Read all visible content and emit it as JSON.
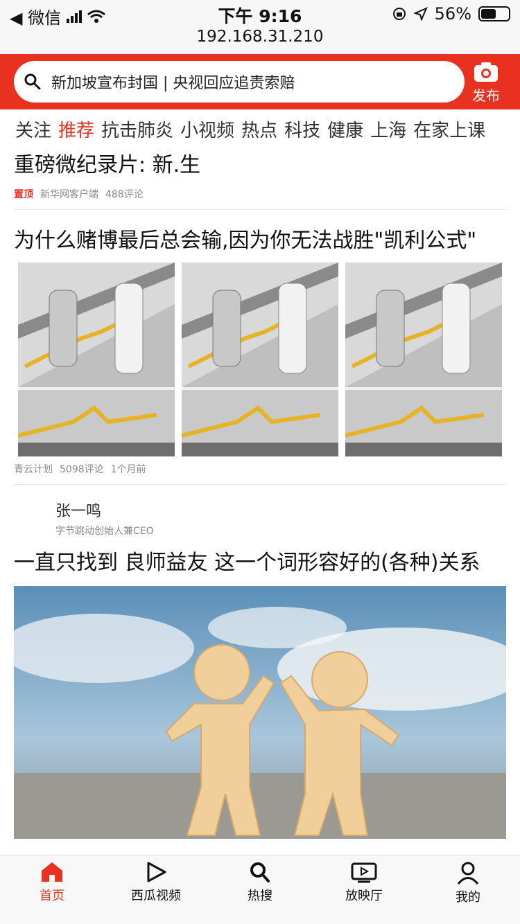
{
  "status": {
    "back_app": "◀ 微信",
    "time": "下午 9:16",
    "url": "192.168.31.210",
    "battery_percent": "56%",
    "battery_level": 0.56
  },
  "search": {
    "query": "新加坡宣布封国 | 央视回应追责索赔"
  },
  "publish": {
    "label": "发布"
  },
  "tabs": [
    {
      "label": "关注"
    },
    {
      "label": "推荐"
    },
    {
      "label": "抗击肺炎"
    },
    {
      "label": "小视频"
    },
    {
      "label": "热点"
    },
    {
      "label": "科技"
    },
    {
      "label": "健康"
    },
    {
      "label": "上海"
    },
    {
      "label": "在家上课"
    }
  ],
  "feed": {
    "item1": {
      "title": "重磅微纪录片: 新.生",
      "tag": "置顶",
      "source": "新华网客户端",
      "comments": "488评论"
    },
    "item2": {
      "title": "为什么赌博最后总会输,因为你无法战胜\"凯利公式\"",
      "source": "青云计划",
      "comments": "5098评论",
      "time": "1个月前"
    },
    "item3": {
      "author_name": "张一鸣",
      "author_desc": "字节跳动创始人兼CEO",
      "title": "一直只找到 良师益友 这一个词形容好的(各种)关系"
    }
  },
  "bottomnav": [
    {
      "label": "首页",
      "icon": "home-icon"
    },
    {
      "label": "西瓜视频",
      "icon": "play-icon"
    },
    {
      "label": "热搜",
      "icon": "search-icon"
    },
    {
      "label": "放映厅",
      "icon": "tv-icon"
    },
    {
      "label": "我的",
      "icon": "user-icon"
    }
  ],
  "colors": {
    "brand": "#e8321f"
  }
}
